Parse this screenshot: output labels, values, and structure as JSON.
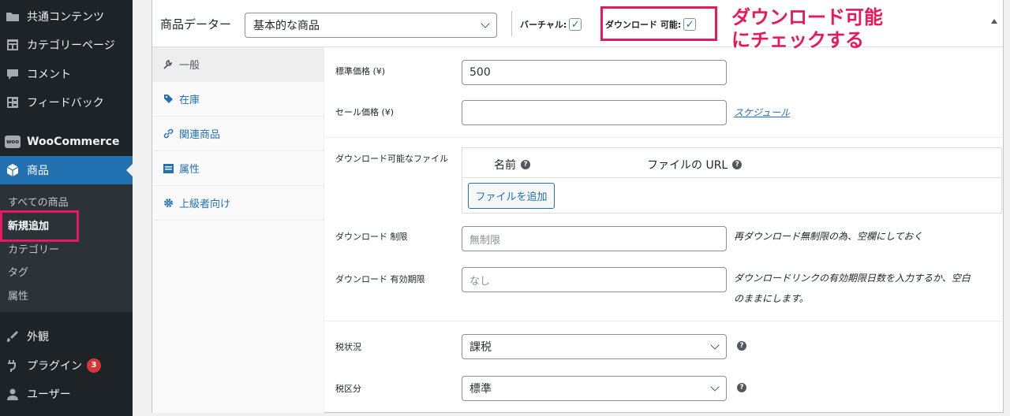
{
  "sidebar": {
    "items": [
      {
        "label": "共通コンテンツ",
        "icon": "folder-icon"
      },
      {
        "label": "カテゴリーページ",
        "icon": "calendar-grid-icon"
      },
      {
        "label": "コメント",
        "icon": "comment-icon"
      },
      {
        "label": "フィードバック",
        "icon": "feedback-icon"
      },
      {
        "label": "WooCommerce",
        "icon": "woocommerce-icon",
        "icon_text": "woo"
      },
      {
        "label": "商品",
        "icon": "product-box-icon"
      },
      {
        "label": "外観",
        "icon": "paintbrush-icon"
      },
      {
        "label": "プラグイン",
        "icon": "plugin-icon",
        "badge": "3"
      },
      {
        "label": "ユーザー",
        "icon": "user-icon"
      }
    ],
    "submenu": [
      "すべての商品",
      "新規追加",
      "カテゴリー",
      "タグ",
      "属性"
    ]
  },
  "product_data": {
    "title": "商品データー",
    "type_select": "基本的な商品",
    "virtual_label": "バーチャル:",
    "downloadable_label": "ダウンロード 可能:",
    "virtual_checked": true,
    "downloadable_checked": true
  },
  "annotation": {
    "line1": "ダウンロード可能",
    "line2": "にチェックする",
    "color": "#e8185a"
  },
  "tabs": [
    {
      "label": "一般",
      "icon": "wrench-icon"
    },
    {
      "label": "在庫",
      "icon": "tag-icon"
    },
    {
      "label": "関連商品",
      "icon": "link-icon"
    },
    {
      "label": "属性",
      "icon": "list-icon"
    },
    {
      "label": "上級者向け",
      "icon": "gear-icon"
    }
  ],
  "general": {
    "regular_price_label": "標準価格 (¥)",
    "regular_price_value": "500",
    "sale_price_label": "セール価格 (¥)",
    "sale_price_value": "",
    "schedule_link": "スケジュール",
    "files_label": "ダウンロード可能なファイル",
    "files_col_name": "名前",
    "files_col_url": "ファイルの URL",
    "add_file_button": "ファイルを追加",
    "download_limit_label": "ダウンロード 制限",
    "download_limit_placeholder": "無制限",
    "download_limit_desc": "再ダウンロード無制限の為、空欄にしておく",
    "download_expiry_label": "ダウンロード 有効期限",
    "download_expiry_placeholder": "なし",
    "download_expiry_desc_1": "ダウンロードリンクの有効期限日数を入力するか、空白",
    "download_expiry_desc_2": "のままにします。",
    "tax_status_label": "税状況",
    "tax_status_value": "課税",
    "tax_class_label": "税区分",
    "tax_class_value": "標準"
  },
  "colors": {
    "accent": "#2271b1",
    "highlight": "#e8185a",
    "sidebar_bg": "#1d2327"
  }
}
